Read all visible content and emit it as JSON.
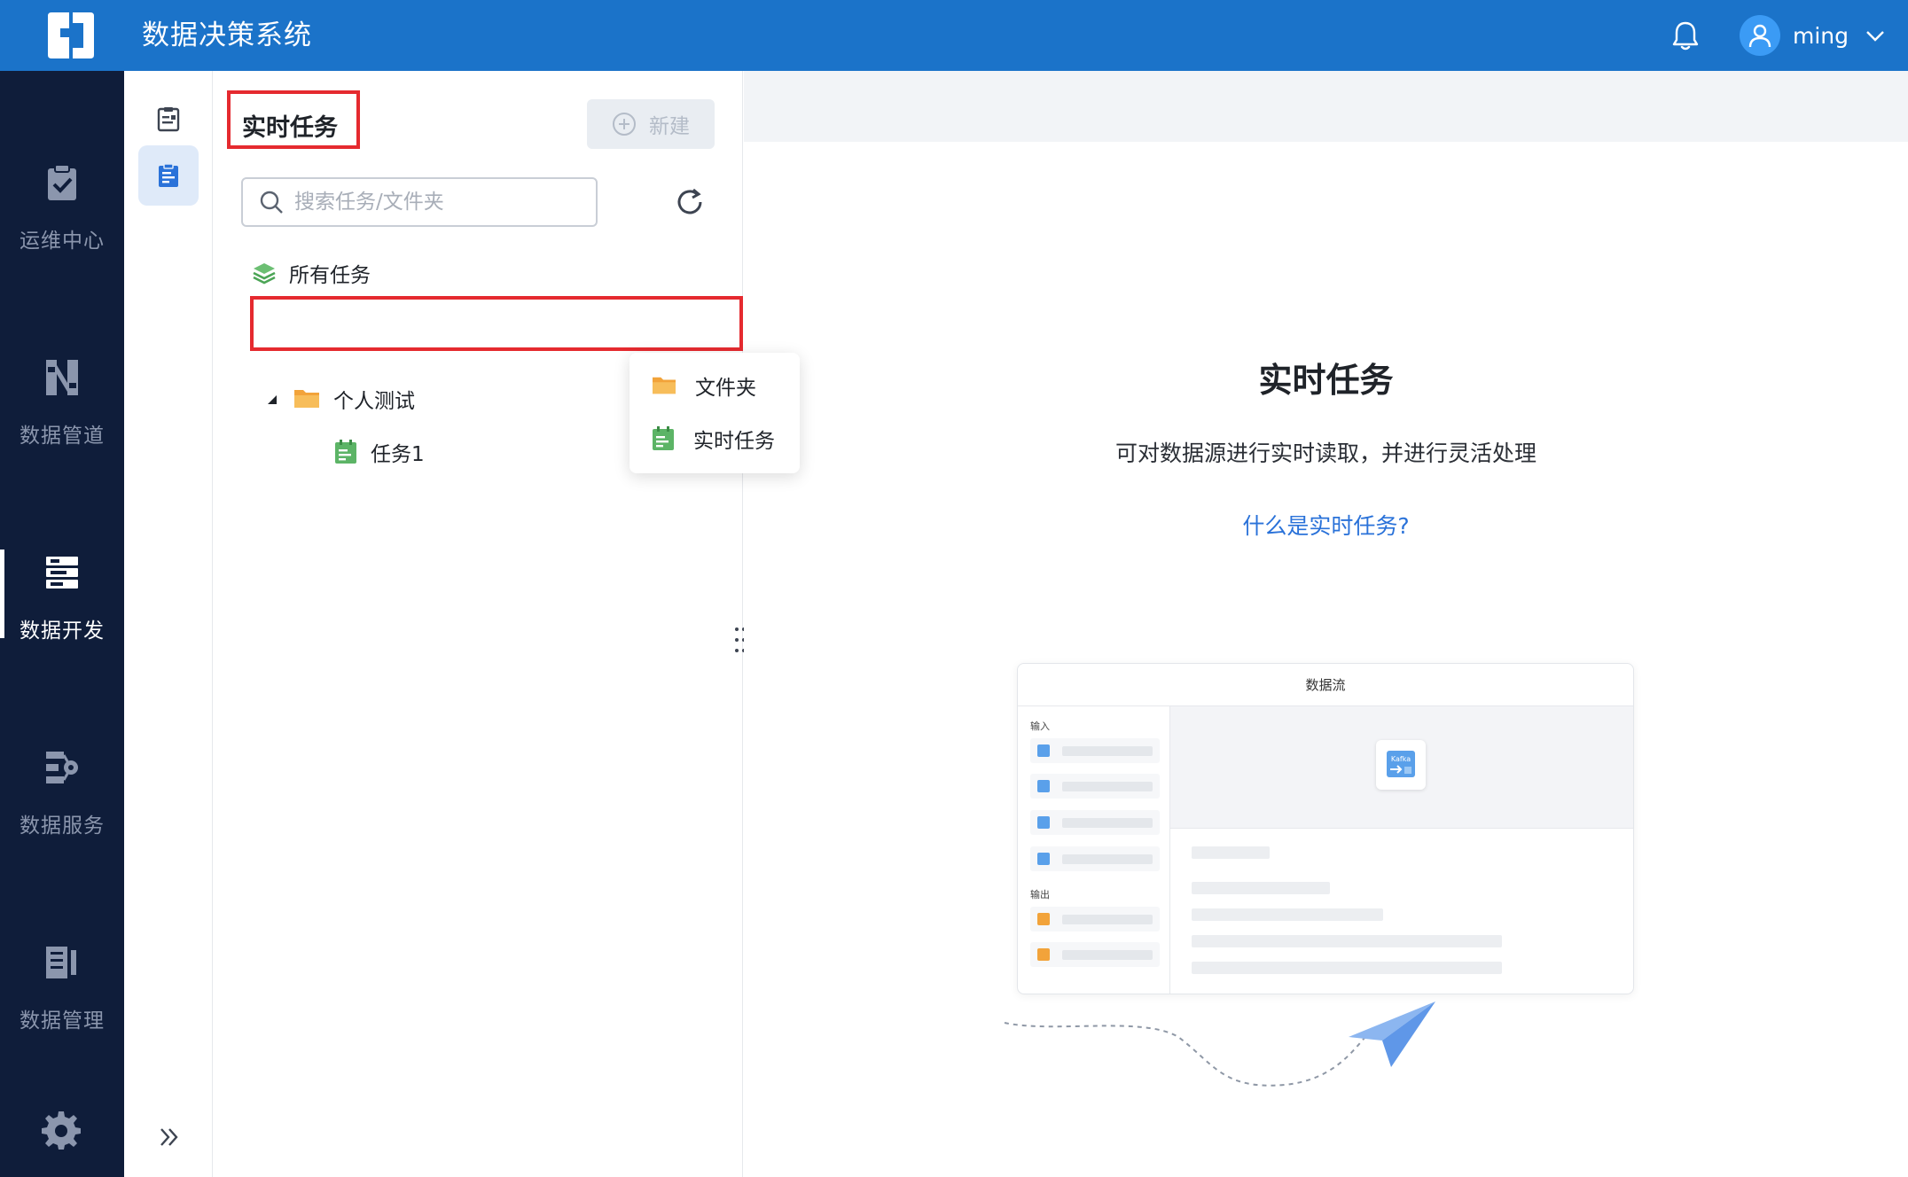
{
  "header": {
    "app_title": "数据决策系统",
    "username": "ming"
  },
  "left_nav": {
    "items": [
      {
        "label": "运维中心",
        "icon": "clipboard-check-icon"
      },
      {
        "label": "数据管道",
        "icon": "pipeline-icon"
      },
      {
        "label": "数据开发",
        "icon": "server-stack-icon",
        "active": true
      },
      {
        "label": "数据服务",
        "icon": "service-icon"
      },
      {
        "label": "数据管理",
        "icon": "manage-icon"
      }
    ]
  },
  "panel": {
    "title": "实时任务",
    "new_button": "新建",
    "search_placeholder": "搜索任务/文件夹",
    "tree": {
      "all_tasks": "所有任务",
      "folder": "个人测试",
      "task": "任务1"
    }
  },
  "dropdown": {
    "items": [
      "文件夹",
      "实时任务"
    ]
  },
  "main": {
    "title": "实时任务",
    "description": "可对数据源进行实时读取，并进行灵活处理",
    "link": "什么是实时任务?"
  },
  "illustration": {
    "title": "数据流",
    "input_label": "输入",
    "output_label": "输出",
    "node_label": "Kafka"
  },
  "colors": {
    "topbar": "#1b73c9",
    "nav_bg": "#0f1d3a",
    "highlight": "#e52a2f",
    "link": "#2a72d9"
  }
}
